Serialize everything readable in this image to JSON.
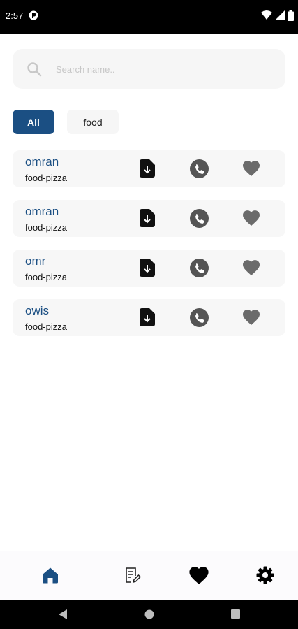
{
  "status_bar": {
    "time": "2:57"
  },
  "search": {
    "placeholder": "Search name.."
  },
  "filters": {
    "all_label": "All",
    "food_label": "food"
  },
  "contacts": [
    {
      "name": "omran",
      "category": "food-pizza"
    },
    {
      "name": "omran",
      "category": "food-pizza"
    },
    {
      "name": "omr",
      "category": "food-pizza"
    },
    {
      "name": "owis",
      "category": "food-pizza"
    }
  ],
  "colors": {
    "accent": "#1b4f83",
    "card_bg": "#f7f7f7",
    "icon_gray": "#555555",
    "heart_gray": "#6b6b6b"
  },
  "bottom_nav": {
    "items": [
      "home-icon",
      "receipt-edit-icon",
      "heart-icon",
      "gear-icon"
    ],
    "active": "home-icon"
  },
  "system_nav": {
    "items": [
      "back-icon",
      "home-circle-icon",
      "recents-icon"
    ]
  }
}
